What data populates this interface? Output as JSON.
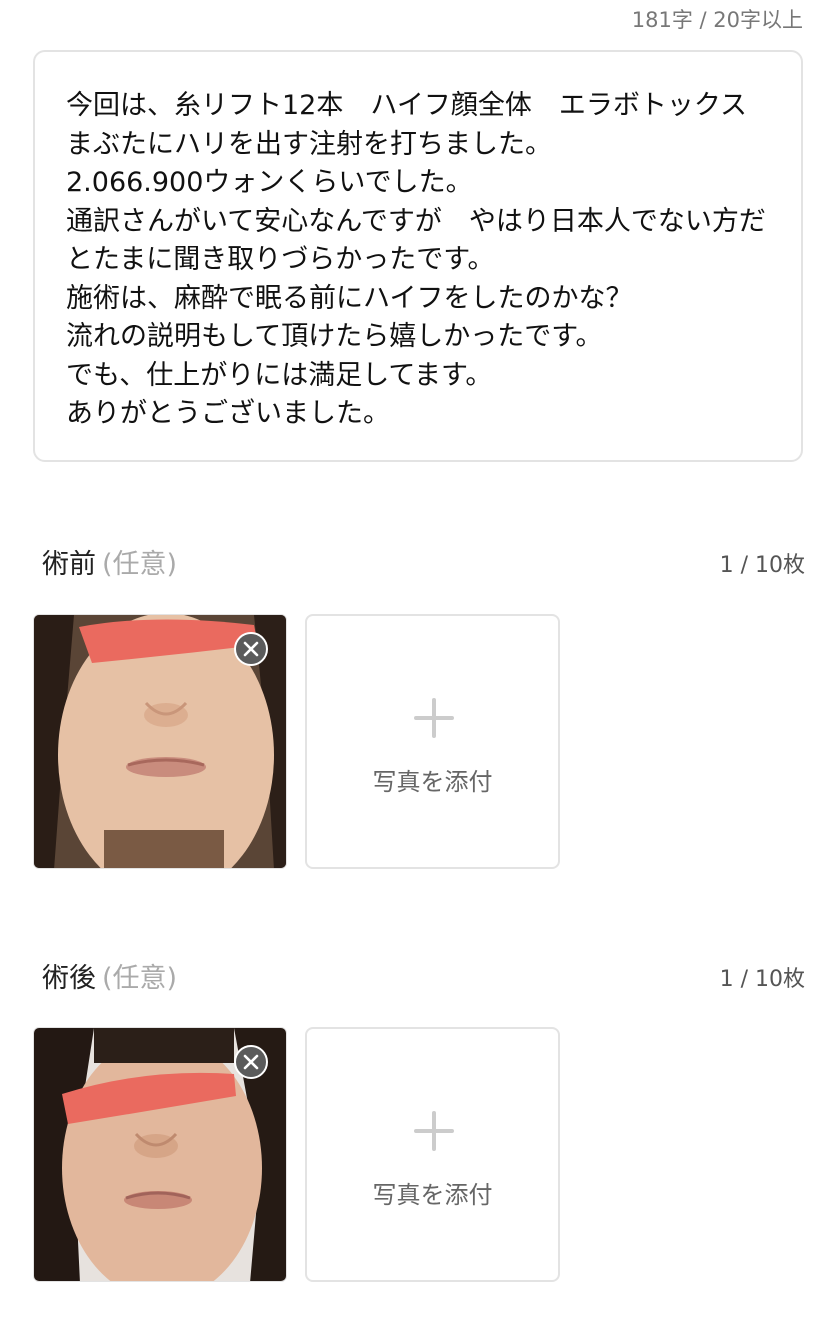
{
  "char_counter": "181字 / 20字以上",
  "review": {
    "text": "今回は、糸リフト12本　ハイフ顔全体　エラボトックス　まぶたにハリを出す注射を打ちました。\n2.066.900ウォンくらいでした。\n通訳さんがいて安心なんですが　やはり日本人でない方だとたまに聞き取りづらかったです。\n施術は、麻酔で眠る前にハイフをしたのかな？\n流れの説明もして頂けたら嬉しかったです。\nでも、仕上がりには満足してます。\nありがとうございました。"
  },
  "before_section": {
    "title": "術前",
    "optional": "(任意)",
    "count": "1 / 10枚",
    "attach_label": "写真を添付"
  },
  "after_section": {
    "title": "術後",
    "optional": "(任意)",
    "count": "1 / 10枚",
    "attach_label": "写真を添付"
  },
  "colors": {
    "border": "#e3e3e3",
    "redaction": "#ea6a5f",
    "muted_text": "#aaaaaa",
    "remove_button": "#5b5b5b"
  },
  "icons": {
    "remove": "close-icon",
    "attach": "plus-icon"
  }
}
